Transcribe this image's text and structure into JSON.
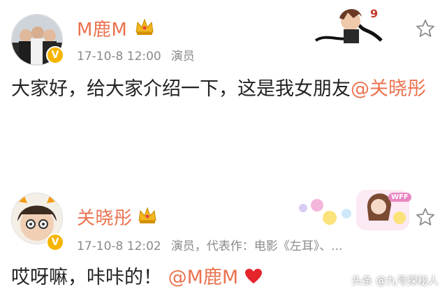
{
  "posts": [
    {
      "author": "M鹿M",
      "timestamp": "17-10-8 12:00",
      "role": "演员",
      "text": "大家好，给大家介绍一下，这是我女朋友",
      "mention": "@关晓彤",
      "card_text": "9"
    },
    {
      "author": "关晓彤",
      "timestamp": "17-10-8 12:02",
      "role": "演员，代表作：电影《左耳》、...",
      "text": "哎呀嘛，咔咔的！",
      "mention": "@M鹿M",
      "card_badge": "WFF"
    }
  ],
  "watermark": "头条 @九号探秘人",
  "colors": {
    "name": "#eb7350",
    "mention": "#eb7350",
    "badge": "#f7b500",
    "meta": "#8a8a8a",
    "heart": "#e5252c"
  },
  "icons": [
    "crown-icon",
    "verified-v-icon",
    "star-icon",
    "heart-icon"
  ]
}
